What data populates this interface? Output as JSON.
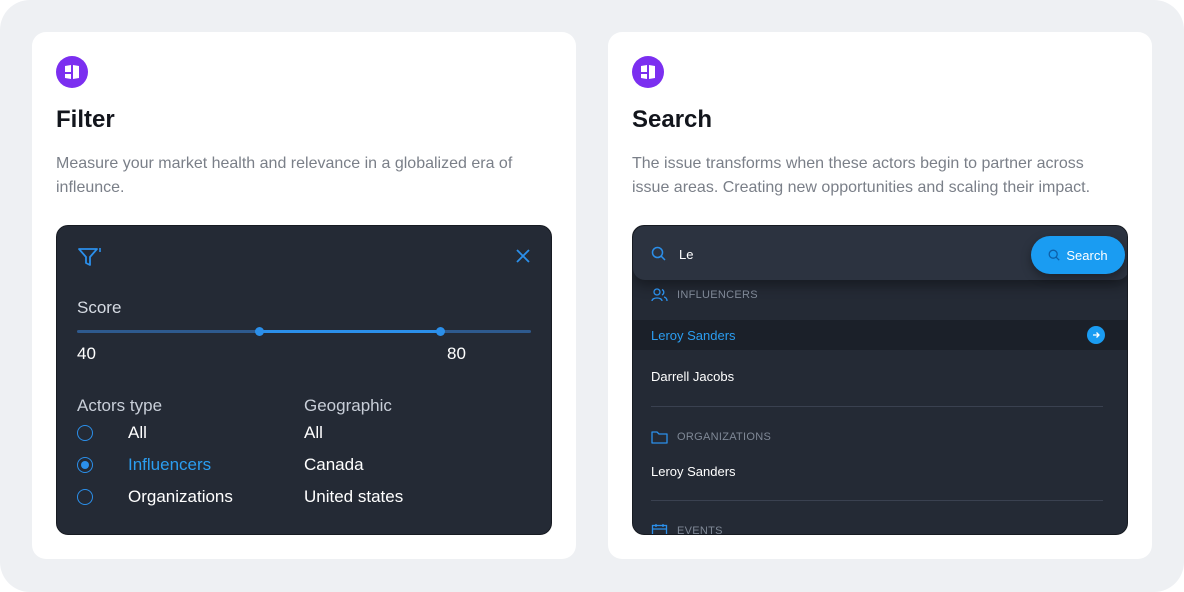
{
  "filter_card": {
    "title": "Filter",
    "description": "Measure your market health and relevance in a globalized era of infleunce.",
    "panel": {
      "score_label": "Score",
      "slider_range": [
        0,
        100
      ],
      "slider_min": 40,
      "slider_max": 80,
      "min_text": "40",
      "max_text": "80",
      "actors_type": {
        "title": "Actors type",
        "options": [
          {
            "label": "All",
            "selected": false
          },
          {
            "label": "Influencers",
            "selected": true
          },
          {
            "label": "Organizations",
            "selected": false
          }
        ]
      },
      "geographic": {
        "title": "Geographic",
        "options": [
          "All",
          "Canada",
          "United states"
        ]
      }
    }
  },
  "search_card": {
    "title": "Search",
    "description": "The issue transforms when these actors begin to partner across issue areas. Creating new opportunities and  scaling their impact.",
    "panel": {
      "query": "Le",
      "button_label": "Search",
      "sections": [
        {
          "title": "INFLUENCERS",
          "icon": "users-icon",
          "items": [
            "Leroy Sanders",
            "Darrell Jacobs"
          ]
        },
        {
          "title": "ORGANIZATIONS",
          "icon": "folder-icon",
          "items": [
            "Leroy Sanders"
          ]
        },
        {
          "title": "EVENTS",
          "icon": "calendar-icon",
          "items": []
        }
      ]
    }
  },
  "colors": {
    "accent": "#2b9df0",
    "panel_bg": "#242a35",
    "logo": "#7b2ff0"
  }
}
